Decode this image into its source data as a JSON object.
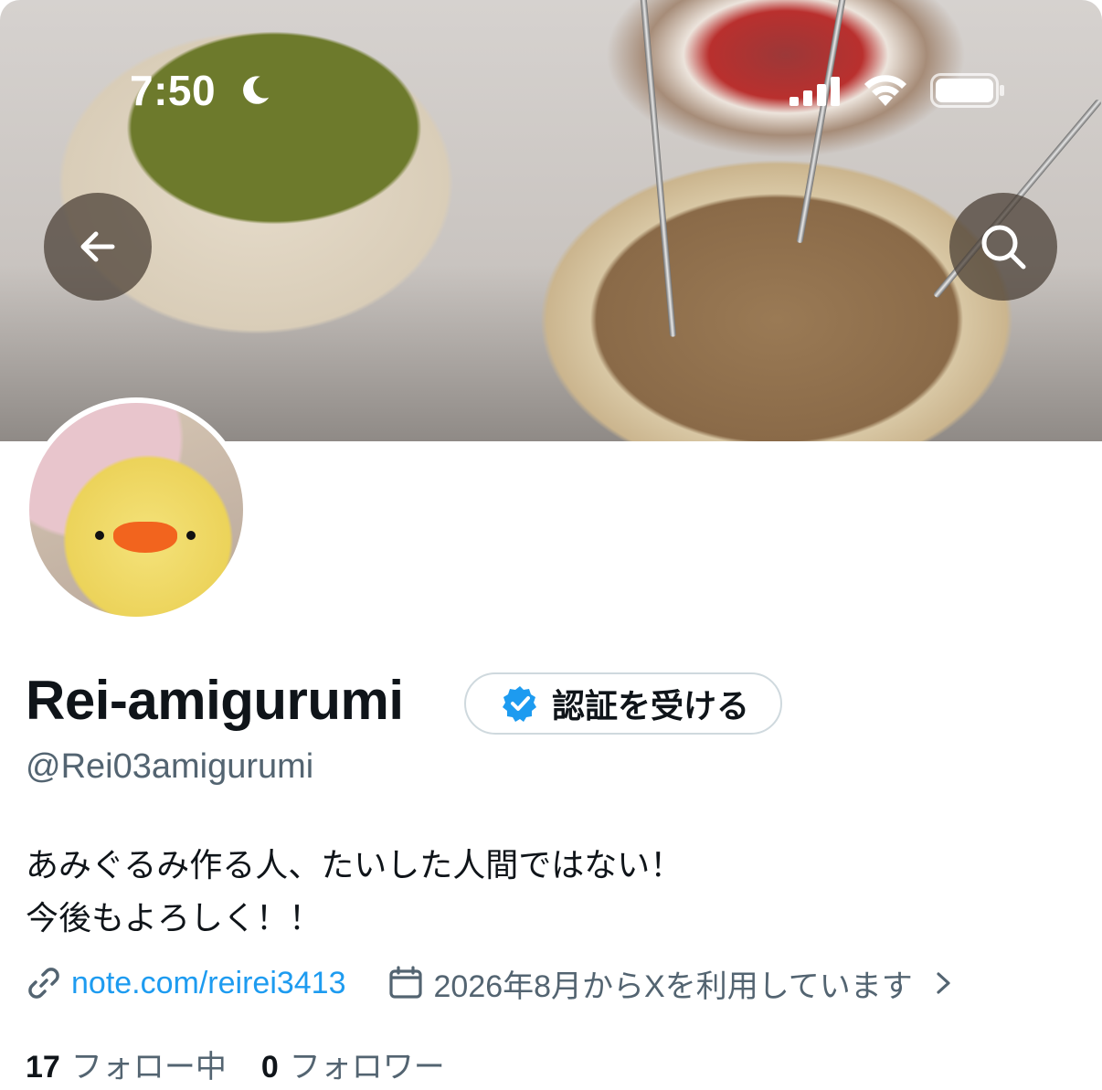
{
  "status_bar": {
    "time": "7:50",
    "icons": [
      "moon-icon",
      "signal-icon",
      "wifi-icon",
      "battery-icon"
    ]
  },
  "header": {
    "back_icon": "arrow-left-icon",
    "search_icon": "search-icon"
  },
  "profile": {
    "display_name": "Rei-amigurumi",
    "verify_label": "認証を受ける",
    "handle": "@Rei03amigurumi",
    "bio_line1": "あみぐるみ作る人、たいした人間ではない！",
    "bio_line2": "今後もよろしく！！",
    "website": "note.com/reirei3413",
    "joined": "2026年8月からXを利用しています",
    "following_count": "17",
    "following_label": "フォロー中",
    "followers_count": "0",
    "followers_label": "フォロワー"
  },
  "colors": {
    "link": "#1d9bf0",
    "secondary_text": "#536471",
    "verified_badge": "#1d9bf0"
  }
}
